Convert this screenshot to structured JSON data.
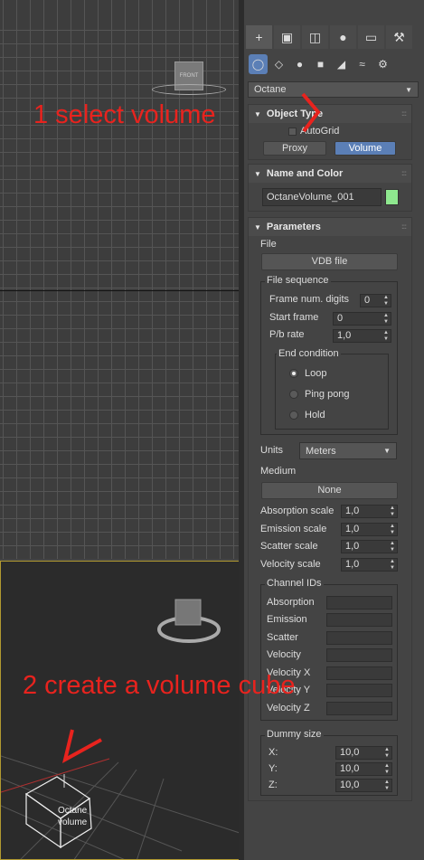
{
  "viewports": {
    "front": {
      "viewcube_label": "FRONT"
    },
    "perspective": {
      "object_label_line1": "Octane",
      "object_label_line2": "volume"
    }
  },
  "command_panel": {
    "tabs": [
      "create-icon",
      "modify-icon",
      "hierarchy-icon",
      "motion-icon",
      "display-icon",
      "utilities-icon"
    ],
    "subtabs": [
      "geometry-icon",
      "shapes-icon",
      "lights-icon",
      "cameras-icon",
      "helpers-icon",
      "spacewarps-icon",
      "systems-icon"
    ],
    "category": "Octane",
    "object_type": {
      "title": "Object Type",
      "autogrid_label": "AutoGrid",
      "buttons": [
        "Proxy",
        "Volume"
      ],
      "pressed": "Volume"
    },
    "name_and_color": {
      "title": "Name and Color",
      "name_value": "OctaneVolume_001",
      "color": "#8fe88f"
    },
    "parameters": {
      "title": "Parameters",
      "file_label": "File",
      "file_button": "VDB file",
      "file_sequence": {
        "title": "File sequence",
        "frame_num_digits": {
          "label": "Frame num. digits",
          "value": "0"
        },
        "start_frame": {
          "label": "Start frame",
          "value": "0"
        },
        "pb_rate": {
          "label": "P/b rate",
          "value": "1,0"
        },
        "end_condition": {
          "title": "End condition",
          "options": [
            "Loop",
            "Ping pong",
            "Hold"
          ],
          "selected": "Loop"
        }
      },
      "units": {
        "label": "Units",
        "value": "Meters"
      },
      "medium": {
        "label": "Medium",
        "button": "None"
      },
      "scales": [
        {
          "label": "Absorption scale",
          "value": "1,0"
        },
        {
          "label": "Emission scale",
          "value": "1,0"
        },
        {
          "label": "Scatter scale",
          "value": "1,0"
        },
        {
          "label": "Velocity scale",
          "value": "1,0"
        }
      ],
      "channel_ids": {
        "title": "Channel IDs",
        "items": [
          "Absorption",
          "Emission",
          "Scatter",
          "Velocity",
          "Velocity X",
          "Velocity Y",
          "Velocity Z"
        ]
      },
      "dummy_size": {
        "title": "Dummy size",
        "x": {
          "label": "X:",
          "value": "10,0"
        },
        "y": {
          "label": "Y:",
          "value": "10,0"
        },
        "z": {
          "label": "Z:",
          "value": "10,0"
        }
      }
    }
  },
  "annotations": {
    "step1": "1 select volume",
    "step2": "2 create a volume cube",
    "color": "#e8231e"
  }
}
